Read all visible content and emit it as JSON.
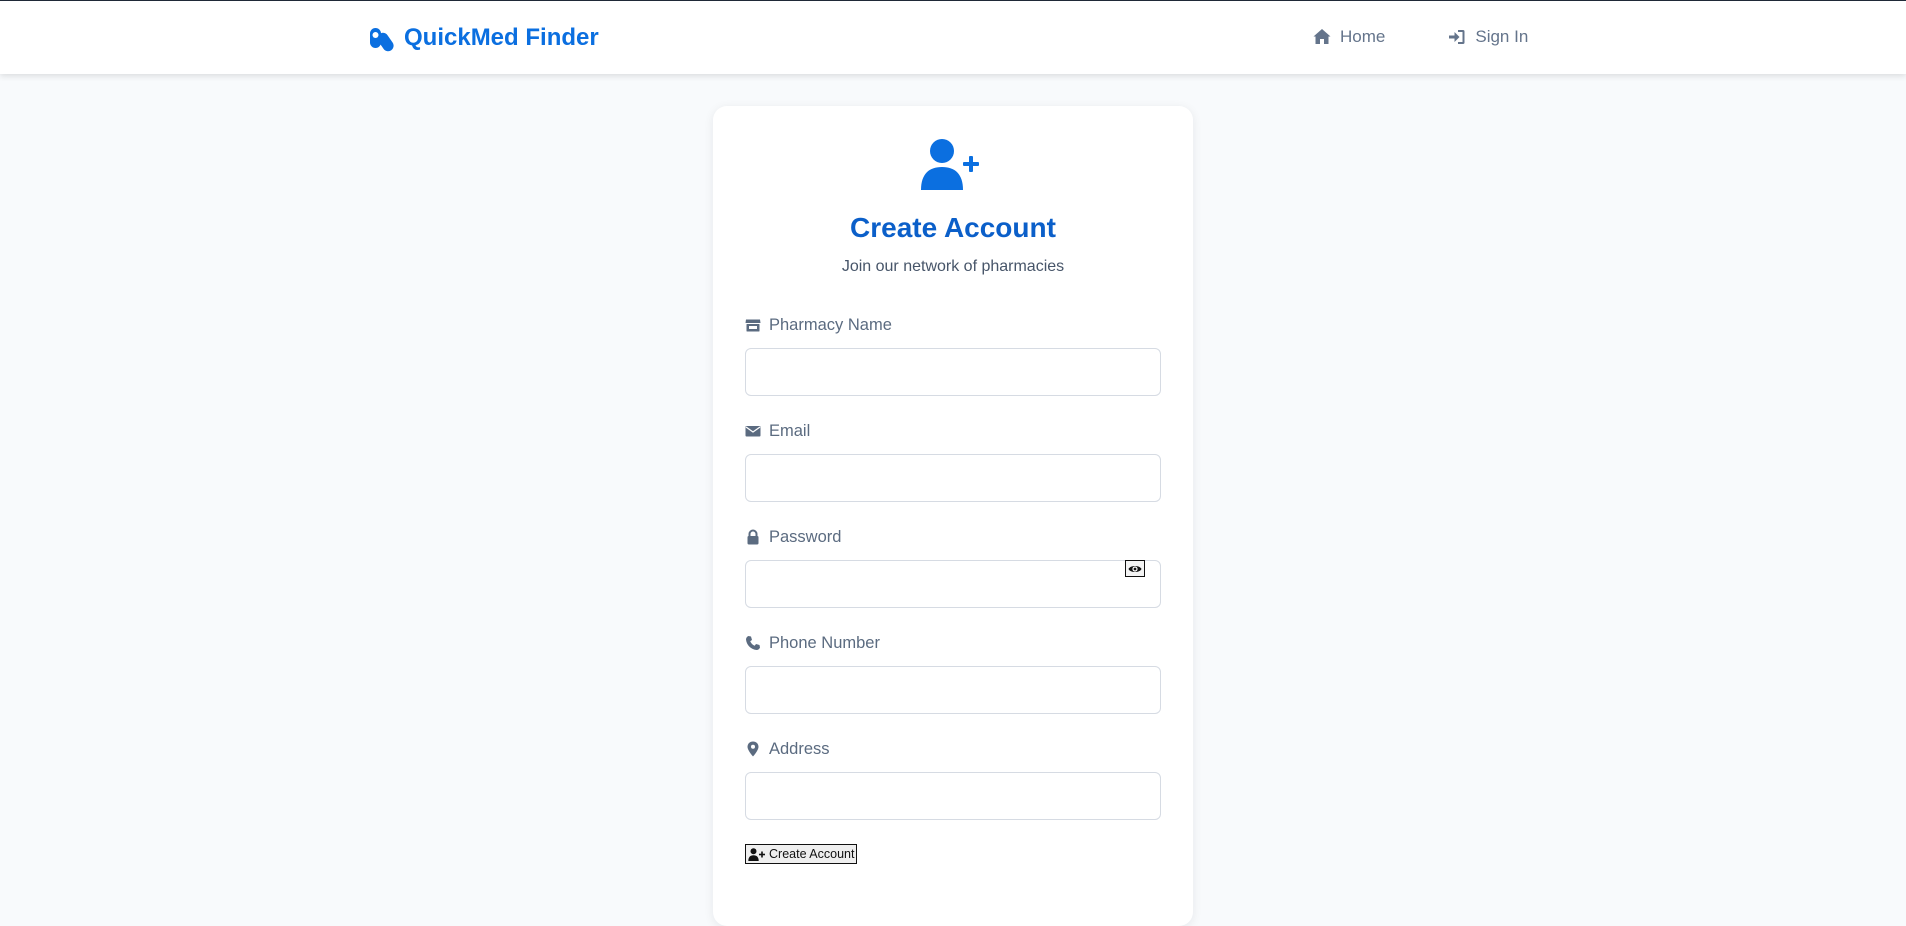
{
  "colors": {
    "brand": "#0b6fe0",
    "title": "#0b5fc9",
    "muted": "#64748b",
    "background": "#f8fafc"
  },
  "navbar": {
    "brand_icon": "capsules-icon",
    "brand_name": "QuickMed Finder",
    "links": [
      {
        "icon": "home-icon",
        "label": "Home"
      },
      {
        "icon": "sign-in-icon",
        "label": "Sign In"
      }
    ]
  },
  "form": {
    "header_icon": "user-plus-icon",
    "title": "Create Account",
    "subtitle": "Join our network of pharmacies",
    "fields": [
      {
        "icon": "store-icon",
        "label": "Pharmacy Name",
        "value": "",
        "placeholder": ""
      },
      {
        "icon": "envelope-icon",
        "label": "Email",
        "value": "",
        "placeholder": ""
      },
      {
        "icon": "lock-icon",
        "label": "Password",
        "value": "",
        "placeholder": "",
        "toggle_icon": "eye-icon"
      },
      {
        "icon": "phone-icon",
        "label": "Phone Number",
        "value": "",
        "placeholder": ""
      },
      {
        "icon": "map-pin-icon",
        "label": "Address",
        "value": "",
        "placeholder": ""
      }
    ],
    "submit": {
      "icon": "user-plus-icon",
      "label": "Create Account"
    }
  }
}
